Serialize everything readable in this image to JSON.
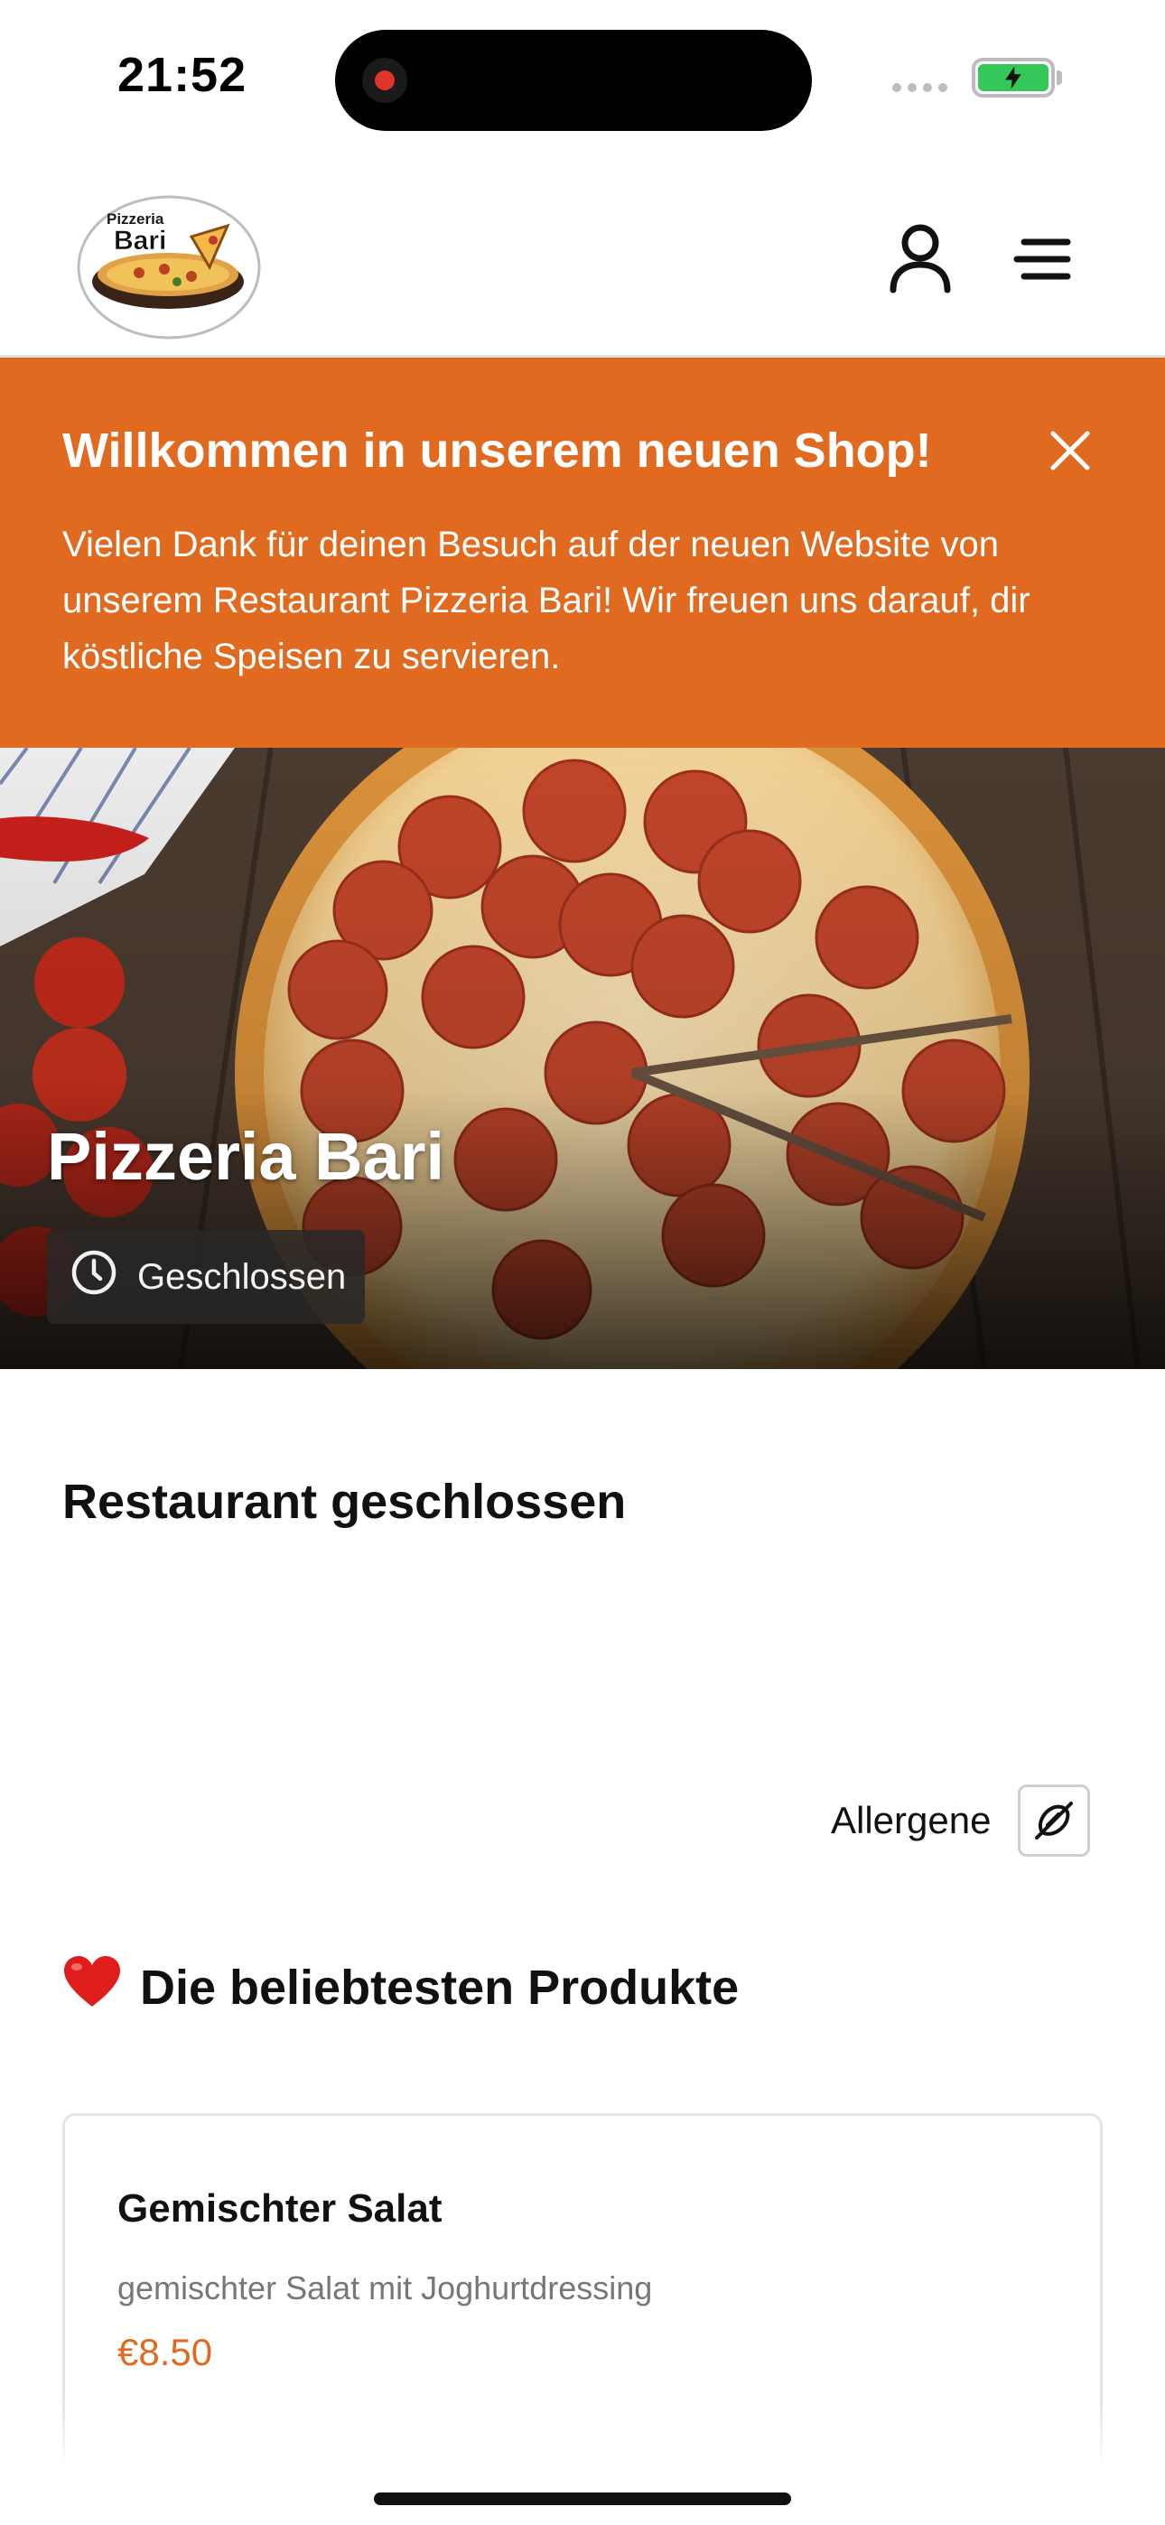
{
  "status_bar": {
    "time": "21:52"
  },
  "header": {
    "logo_text_top": "Pizzeria",
    "logo_text_bottom": "Bari"
  },
  "banner": {
    "title": "Willkommen in unserem neuen Shop!",
    "text": "Vielen Dank für deinen Besuch auf der neuen Website von unserem Restaurant Pizzeria Bari! Wir freuen uns darauf, dir köstliche Speisen zu servieren."
  },
  "hero": {
    "title": "Pizzeria Bari",
    "status": "Geschlossen"
  },
  "main": {
    "closed_heading": "Restaurant geschlossen",
    "allergen_label": "Allergene",
    "popular_emoji": "❤️",
    "popular_heading": "Die beliebtesten Produkte"
  },
  "products": [
    {
      "name": "Gemischter Salat",
      "description": "gemischter Salat mit Joghurtdressing",
      "price": "€8.50"
    }
  ],
  "colors": {
    "accent": "#e06a1f",
    "badge_bg": "#282828",
    "battery": "#35c759"
  }
}
